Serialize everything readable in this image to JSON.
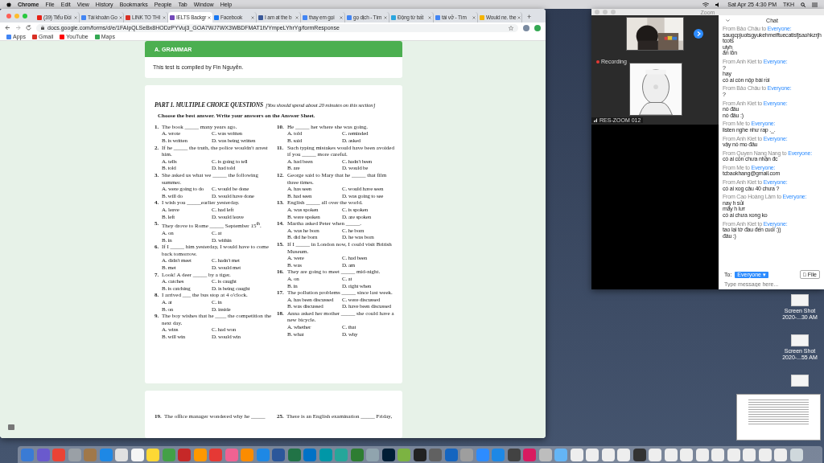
{
  "menu_bar": {
    "app": "Chrome",
    "items": [
      "File",
      "Edit",
      "View",
      "History",
      "Bookmarks",
      "People",
      "Tab",
      "Window",
      "Help"
    ],
    "clock": "Sat Apr 25  4:30 PM",
    "user": "TKH"
  },
  "browser": {
    "tabs": [
      {
        "label": "(39) Tiểu Đồi",
        "color": "#e62117",
        "selected": false
      },
      {
        "label": "Tài khoản Go",
        "color": "#4285f4",
        "selected": false
      },
      {
        "label": "LINK TO THI",
        "color": "#d93025",
        "selected": false
      },
      {
        "label": "IELTS Backgr",
        "color": "#7248b9",
        "selected": true
      },
      {
        "label": "Facebook",
        "color": "#1877f2",
        "selected": false
      },
      {
        "label": "I am at the b",
        "color": "#3b5998",
        "selected": false
      },
      {
        "label": "thay em gọi",
        "color": "#4285f4",
        "selected": false
      },
      {
        "label": "gọ dịch - Tìm",
        "color": "#4285f4",
        "selected": false
      },
      {
        "label": "Động từ bất",
        "color": "#2aa6de",
        "selected": false
      },
      {
        "label": "tài vở - Tìm",
        "color": "#4285f4",
        "selected": false
      },
      {
        "label": "Would ne. the",
        "color": "#f4b400",
        "selected": false
      }
    ],
    "new_tab": "+",
    "url": "docs.google.com/forms/d/e/1FAIpQLSeBx8HODzPYVuj3_GOA7WJ7WX3WBDFMAT1tVYmpeLYhrYg/formResponse",
    "bookmarks": [
      {
        "label": "Apps",
        "color": "#4285f4"
      },
      {
        "label": "Gmail",
        "color": "#d93025"
      },
      {
        "label": "YouTube",
        "color": "#ff0000"
      },
      {
        "label": "Maps",
        "color": "#34a853"
      }
    ]
  },
  "form": {
    "section": "A. GRAMMAR",
    "note": "This test is compiled by Fin Nguyễn.",
    "part_title": "PART 1. MULTIPLE CHOICE QUESTIONS",
    "part_hint": "[You should spend about 20 minutes on this section]",
    "instruction": "Choose the best answer. Write your answers on the Answer Sheet.",
    "columns": [
      [
        {
          "number": "1.",
          "text": "The book _____ many years ago.",
          "options": [
            "A. wrote",
            "C. was written",
            "B. is written",
            "D. was being written"
          ]
        },
        {
          "number": "2.",
          "text": "If he _____ the truth, the police wouldn't arrest him.",
          "options": [
            "A. tells",
            "C. is going to tell",
            "B. told",
            "D. had told"
          ]
        },
        {
          "number": "3.",
          "text": "She asked us what we _____ the following summer.",
          "options": [
            "A. were going to do",
            "C. would be done",
            "B. will do",
            "D. would have done"
          ]
        },
        {
          "number": "4.",
          "text": "I wish you _____earlier yesterday.",
          "options": [
            "A. leave",
            "C. had left",
            "B. left",
            "D. would leave"
          ]
        },
        {
          "number": "5.",
          "text": "They drove to Rome _____ September 15$^{th}$.",
          "options": [
            "A. on",
            "C. at",
            "B. in",
            "D. within"
          ]
        },
        {
          "number": "6.",
          "text": "If I _____ him yesterday, I would have to come back tomorrow.",
          "options": [
            "A. didn't meet",
            "C. hadn't met",
            "B. met",
            "D. would met"
          ]
        },
        {
          "number": "7.",
          "text": "Look! A deer _____ by a tiger.",
          "options": [
            "A. catches",
            "C. is caught",
            "B. is catching",
            "D. is being caught"
          ]
        },
        {
          "number": "8.",
          "text": "I arrived ___ the bus stop at 4 o'clock.",
          "options": [
            "A. at",
            "C. in",
            "B. on",
            "D. inside"
          ]
        },
        {
          "number": "9.",
          "text": "The boy wishes that he ____ the competition the next day.",
          "options": [
            "A. wins",
            "C. had won",
            "B. will win",
            "D. would win"
          ]
        }
      ],
      [
        {
          "number": "10.",
          "text": "He _____ her where she was going.",
          "options": [
            "A. told",
            "C. reminded",
            "B. said",
            "D. asked"
          ]
        },
        {
          "number": "11.",
          "text": "Such typing mistakes would have been avoided if you _____ more careful.",
          "options": [
            "A. had been",
            "C. hadn't been",
            "B. are",
            "D. would be"
          ]
        },
        {
          "number": "12.",
          "text": "George said to Mary that he _____ that film three times.",
          "options": [
            "A. has seen",
            "C. would have seen",
            "B. had seen",
            "D. was going to see"
          ]
        },
        {
          "number": "13.",
          "text": "English _____ all over the world.",
          "options": [
            "A. was spoken",
            "C. is spoken",
            "B. were spoken",
            "D. are spoken"
          ]
        },
        {
          "number": "14.",
          "text": "Martha asked Peter when _____.",
          "options": [
            "A. was he born",
            "C. he born",
            "B. did he born",
            "D. he was born"
          ]
        },
        {
          "number": "15.",
          "text": "If I _____ in London now, I could visit British Museum.",
          "options": [
            "A. were",
            "C. had been",
            "B. was",
            "D. am"
          ]
        },
        {
          "number": "16.",
          "text": "They are going to meet _____ mid-night.",
          "options": [
            "A. on",
            "C. at",
            "B. in",
            "D. right when"
          ]
        },
        {
          "number": "17.",
          "text": "The pollution problems _____ since last week.",
          "options": [
            "A. has been discussed",
            "C. were discussed",
            "B. was discussed",
            "D. have been discussed"
          ]
        },
        {
          "number": "18.",
          "text": "Anna asked her mother _____ she could have a new bicycle.",
          "options": [
            "A. whether",
            "C. that",
            "B. what",
            "D. why"
          ]
        }
      ]
    ],
    "next_page": [
      {
        "number": "19.",
        "text": "The office manager wondered why he _____"
      },
      {
        "number": "25.",
        "text": "There is an English examination _____ Friday,"
      }
    ]
  },
  "zoom": {
    "title": "Zoom",
    "recording": "Recording",
    "meeting_name": "RES-ZOOM 012",
    "chat": {
      "title": "Chat",
      "messages": [
        {
          "sender": "From Bảo Châu to",
          "recipient": "Everyone:",
          "lines": [
            "saugcpjuotsgyukehmeiftuecatisfjsaohkzrjhtcots",
            "uiyh",
            "ẩn lỗn"
          ]
        },
        {
          "sender": "From Anh Kiet to",
          "recipient": "Everyone:",
          "lines": [
            "?",
            "hay",
            "có ai còn nộp bài rồi"
          ]
        },
        {
          "sender": "From Bảo Châu to",
          "recipient": "Everyone:",
          "lines": [
            "?"
          ]
        },
        {
          "sender": "From Anh Kiet to",
          "recipient": "Everyone:",
          "lines": [
            "nó đâu",
            "nó đâu :)"
          ]
        },
        {
          "sender": "From Me to",
          "recipient": "Everyone:",
          "lines": [
            "listen nghe như rap ._."
          ]
        },
        {
          "sender": "From Anh Kiet to",
          "recipient": "Everyone:",
          "lines": [
            "vậy nó mo đâu"
          ]
        },
        {
          "sender": "From Quyen Nang Nang to",
          "recipient": "Everyone:",
          "lines": [
            "có ai còn chưa nhận đc"
          ]
        },
        {
          "sender": "From Me to",
          "recipient": "Everyone:",
          "lines": [
            "tcbaokhang@gmail.com"
          ]
        },
        {
          "sender": "From Anh Kiet to",
          "recipient": "Everyone:",
          "lines": [
            "có ai xog câu 40 chưa ?"
          ]
        },
        {
          "sender": "From Cao Hoàng Lâm to",
          "recipient": "Everyone:",
          "lines": [
            "nay h sủi",
            "mãy h lưr",
            "có ai chưa xong ko"
          ]
        },
        {
          "sender": "From Anh Kiet to",
          "recipient": "Everyone:",
          "lines": [
            "tao lại tờ đầu đến cuối :))",
            "đâu :)"
          ]
        }
      ],
      "to_label": "To:",
      "to_value": "Everyone ▾",
      "file_button": "File",
      "placeholder": "Type message here..."
    }
  },
  "desktop_files": [
    {
      "label": "Screen Shot 2020-...30 AM"
    },
    {
      "label": "Screen Shot 2020-...55 AM"
    }
  ],
  "dock": [
    {
      "color": "#3a7bd5"
    },
    {
      "color": "#6a5acd"
    },
    {
      "color": "#ea4335"
    },
    {
      "color": "#9aa0a6"
    },
    {
      "color": "#a0784a"
    },
    {
      "color": "#1e88e5"
    },
    {
      "color": "#e0e0e0"
    },
    {
      "color": "#f5f5f5"
    },
    {
      "color": "#fdd835"
    },
    {
      "color": "#43a047"
    },
    {
      "color": "#c62828"
    },
    {
      "color": "#ff9800"
    },
    {
      "color": "#e53935"
    },
    {
      "color": "#f06292"
    },
    {
      "color": "#fb8c00"
    },
    {
      "color": "#1e88e5"
    },
    {
      "color": "#2b579a"
    },
    {
      "color": "#217346"
    },
    {
      "color": "#0072c6"
    },
    {
      "color": "#0097a7"
    },
    {
      "color": "#26a69a"
    },
    {
      "color": "#2e7d32"
    },
    {
      "color": "#90a4ae"
    },
    {
      "color": "#001e36"
    },
    {
      "color": "#7cb342"
    },
    {
      "color": "#222222"
    },
    {
      "color": "#616161"
    },
    {
      "color": "#1565c0"
    },
    {
      "color": "#9e9e9e"
    },
    {
      "color": "#2d8cff"
    },
    {
      "color": "#1e88e5"
    },
    {
      "color": "#424242"
    },
    {
      "color": "#d81b60"
    },
    {
      "color": "#bdbdbd"
    },
    {
      "color": "#64b5f6"
    },
    {
      "color": "#eeeeee"
    },
    {
      "color": "#eeeeee"
    },
    {
      "color": "#eeeeee"
    },
    {
      "color": "#eeeeee"
    },
    {
      "color": "#333333"
    },
    {
      "color": "#eeeeee"
    },
    {
      "color": "#eeeeee"
    },
    {
      "color": "#eeeeee"
    },
    {
      "color": "#eeeeee"
    },
    {
      "color": "#eeeeee"
    },
    {
      "color": "#eeeeee"
    },
    {
      "color": "#eeeeee"
    },
    {
      "color": "#eeeeee"
    },
    {
      "color": "#eeeeee"
    },
    {
      "color": "#cfd8dc"
    }
  ]
}
